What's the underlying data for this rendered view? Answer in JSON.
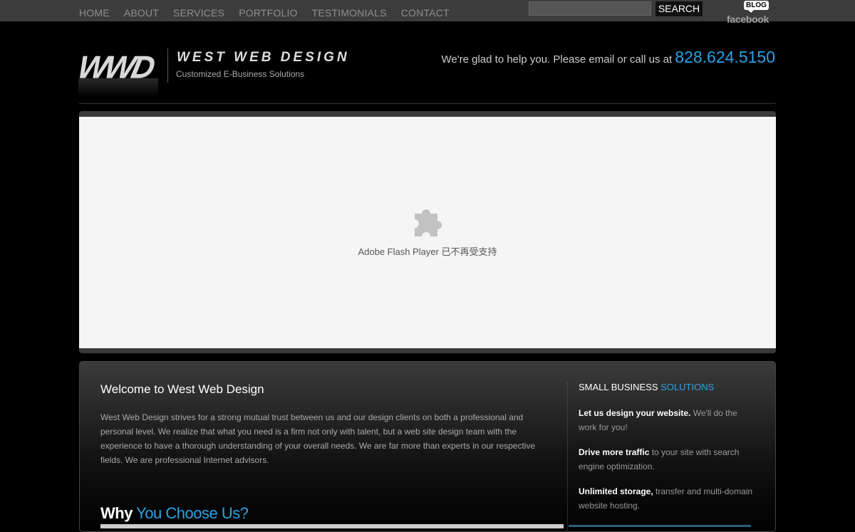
{
  "nav": {
    "items": [
      "HOME",
      "ABOUT",
      "SERVICES",
      "PORTFOLIO",
      "TESTIMONIALS",
      "CONTACT"
    ]
  },
  "search": {
    "button_label": "SEARCH",
    "value": ""
  },
  "social": {
    "blog_label": "BLOG",
    "facebook_label": "facebook"
  },
  "header": {
    "logo_mark": "WWD",
    "brand_name": "WEST WEB DESIGN",
    "tagline": "Customized E-Business Solutions",
    "contact_text": "We're glad to help you. Please email or call us at",
    "phone": "828.624.5150"
  },
  "flash": {
    "message": "Adobe Flash Player 已不再受支持"
  },
  "welcome": {
    "title": "Welcome to West Web Design",
    "body": "West Web Design strives for a strong mutual trust between us and our design clients on both a professional and personal level. We realize that what you need is a firm not only with talent, but a web site design team with the experience to have a thorough understanding of your overall needs. We are far more than experts in our respective fields. We are professional Internet advisors."
  },
  "why": {
    "part1": "Why",
    "part2": "You Choose Us?"
  },
  "solutions": {
    "title_main": "SMALL BUSINESS",
    "title_accent": "SOLUTIONS",
    "items": [
      {
        "bold": "Let us design your website.",
        "rest": " We'll do the work for you!"
      },
      {
        "bold": "Drive more traffic",
        "rest": " to your site with search engine optimization."
      },
      {
        "bold": "Unlimited storage,",
        "rest": " transfer and multi-domain website hosting."
      }
    ]
  },
  "colors": {
    "accent": "#29a3e6",
    "nav_bar": "#3c3c3c",
    "background": "#000000"
  }
}
